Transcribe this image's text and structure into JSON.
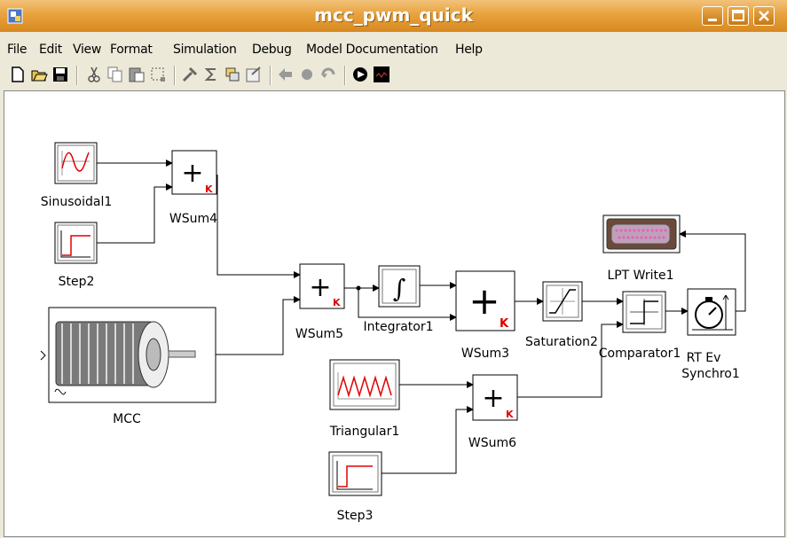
{
  "window": {
    "title": "mcc_pwm_quick"
  },
  "menu": [
    "File",
    "Edit",
    "View",
    "Format",
    "Simulation",
    "Debug",
    "Model Documentation",
    "Help"
  ],
  "toolbar": [
    "new-icon",
    "open-icon",
    "save-icon",
    "cut-icon",
    "copy-icon",
    "paste-icon",
    "select-icon",
    "build-icon",
    "sum-icon",
    "region-icon",
    "context-icon",
    "start-icon",
    "stop-icon",
    "resume-icon",
    "scope-icon",
    "display-icon"
  ],
  "blocks": {
    "sinusoidal1": "Sinusoidal1",
    "step2": "Step2",
    "wsum4": "WSum4",
    "mcc": "MCC",
    "wsum5": "WSum5",
    "integrator1": "Integrator1",
    "wsum3": "WSum3",
    "saturation2": "Saturation2",
    "lpt_write1": "LPT Write1",
    "comparator1": "Comparator1",
    "rt_ev_synchro1_line1": "RT Ev",
    "rt_ev_synchro1_line2": "Synchro1",
    "triangular1": "Triangular1",
    "wsum6": "WSum6",
    "step3": "Step3"
  },
  "symbols": {
    "plus": "+",
    "gain": "K",
    "integral": "∫"
  },
  "colors": {
    "title_bar": "#e8a23d",
    "accent_red": "#e00000",
    "canvas": "#ffffff"
  }
}
